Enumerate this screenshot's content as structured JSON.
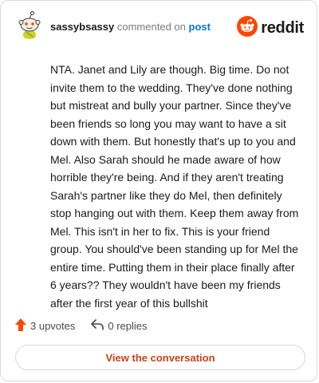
{
  "comment": {
    "username": "sassybsassy",
    "verb": "commented on",
    "target": "post",
    "text": "NTA. Janet and Lily are though. Big time. Do not invite them to the wedding. They've done nothing but mistreat and bully your partner. Since they've been friends so long you may want to have a sit down with them. But honestly that's up to you and Mel. Also Sarah should he made aware of how horrible they're being. And if they aren't treating Sarah's partner like they do Mel, then definitely stop hanging out with them. Keep them away from Mel. This isn't in her to fix. This is your friend group. You should've been standing up for Mel the entire time. Putting them in their place finally after 6 years?? They wouldn't have been my friends after the first year of this bullshit"
  },
  "brand": {
    "wordmark": "reddit",
    "color": "#ff4500"
  },
  "actions": {
    "upvotes": "3 upvotes",
    "replies": "0 replies"
  },
  "cta": {
    "label": "View the conversation",
    "color": "#c9431a"
  },
  "icons": {
    "avatar": "snoo-avatar-icon",
    "brand": "reddit-logo-icon",
    "upvote": "upvote-arrow-icon",
    "reply": "reply-arrow-icon"
  }
}
